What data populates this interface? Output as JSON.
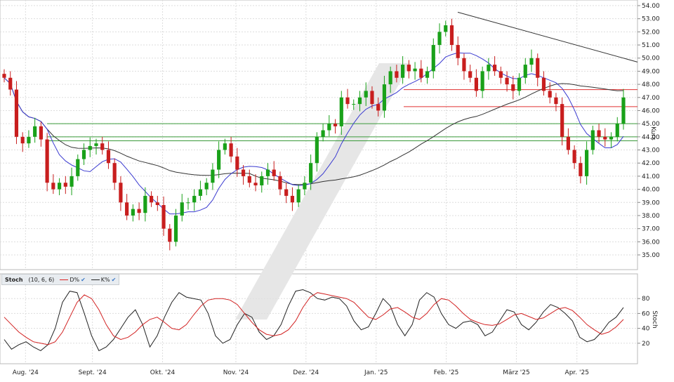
{
  "chart_data": [
    {
      "type": "candlestick",
      "ylabel": "Kurs",
      "ylim": [
        34,
        54
      ],
      "yticks": [
        "35.00",
        "36.00",
        "37.00",
        "38.00",
        "39.00",
        "40.00",
        "41.00",
        "42.00",
        "43.00",
        "44.00",
        "45.00",
        "46.00",
        "47.00",
        "48.00",
        "49.00",
        "50.00",
        "51.00",
        "52.00",
        "53.00",
        "54.00"
      ],
      "x_labels": [
        "Aug. '24",
        "Sept. '24",
        "Okt. '24",
        "Nov. '24",
        "Dez. '24",
        "Jan. '25",
        "Feb. '25",
        "März '25",
        "Apr. '25"
      ],
      "grid": true,
      "horizontal_lines": [
        {
          "value": 47.6,
          "color": "#e03030"
        },
        {
          "value": 46.3,
          "color": "#e03030"
        },
        {
          "value": 45.0,
          "color": "#3a9a3a"
        },
        {
          "value": 44.0,
          "color": "#3a9a3a"
        },
        {
          "value": 43.7,
          "color": "#3a9a3a"
        }
      ],
      "trendline": {
        "from_date": "Feb. '25",
        "from_value": 53.5,
        "to_value": 49.7,
        "color": "#333333"
      },
      "series": [
        {
          "kind": "close",
          "values": [
            48.5,
            47.6,
            44.0,
            43.5,
            44.0,
            44.8,
            43.8,
            40.5,
            40.0,
            40.5,
            40.2,
            41.0,
            42.3,
            43.0,
            43.3,
            43.5,
            43.0,
            42.0,
            40.5,
            39.0,
            38.0,
            38.5,
            38.2,
            39.5,
            39.0,
            38.8,
            37.0,
            36.0,
            38.0,
            39.0,
            39.0,
            39.5,
            40.0,
            40.5,
            41.5,
            43.0,
            43.5,
            42.5,
            41.5,
            41.0,
            40.5,
            40.3,
            41.0,
            41.5,
            41.0,
            40.0,
            39.5,
            39.0,
            40.0,
            40.5,
            42.0,
            44.0,
            44.5,
            45.0,
            44.8,
            47.0,
            46.5,
            46.5,
            47.0,
            47.5,
            46.5,
            46.0,
            48.0,
            49.0,
            48.5,
            49.5,
            49.0,
            49.2,
            48.5,
            49.0,
            51.0,
            52.0,
            52.5,
            51.0,
            50.0,
            49.0,
            48.5,
            47.5,
            49.0,
            49.5,
            49.0,
            48.5,
            48.0,
            47.5,
            48.5,
            49.5,
            50.0,
            48.5,
            47.5,
            47.0,
            46.5,
            44.0,
            43.0,
            42.0,
            41.0,
            43.0,
            44.5,
            44.0,
            43.8,
            44.0,
            45.0,
            47.0
          ]
        },
        {
          "kind": "moving-average-short",
          "color": "#3a3ad0"
        },
        {
          "kind": "moving-average-long",
          "color": "#333333"
        }
      ]
    },
    {
      "type": "line",
      "title": "Stoch",
      "params": "(10, 6, 6)",
      "ylim": [
        0,
        100
      ],
      "yticks": [
        "20",
        "40",
        "60",
        "80"
      ],
      "ylabel": "Stoch",
      "legend": [
        "D%",
        "K%"
      ],
      "series": [
        {
          "name": "K%",
          "color": "#222222",
          "values": [
            25,
            12,
            18,
            22,
            15,
            10,
            18,
            40,
            75,
            90,
            88,
            60,
            30,
            10,
            15,
            25,
            40,
            55,
            65,
            45,
            15,
            30,
            55,
            75,
            88,
            82,
            80,
            78,
            60,
            30,
            20,
            25,
            45,
            60,
            55,
            35,
            25,
            30,
            45,
            70,
            90,
            92,
            88,
            80,
            78,
            82,
            80,
            70,
            50,
            38,
            42,
            60,
            80,
            70,
            45,
            30,
            45,
            78,
            88,
            82,
            60,
            45,
            40,
            48,
            50,
            45,
            30,
            35,
            50,
            65,
            62,
            45,
            38,
            48,
            62,
            72,
            68,
            60,
            50,
            28,
            22,
            25,
            35,
            48,
            55,
            68
          ]
        },
        {
          "name": "D%",
          "color": "#d22222",
          "values": [
            55,
            45,
            35,
            28,
            22,
            20,
            18,
            22,
            35,
            55,
            75,
            85,
            80,
            65,
            45,
            30,
            25,
            28,
            35,
            45,
            52,
            55,
            48,
            40,
            38,
            45,
            58,
            70,
            78,
            80,
            80,
            78,
            72,
            60,
            48,
            38,
            32,
            30,
            32,
            38,
            50,
            68,
            82,
            88,
            86,
            84,
            82,
            80,
            75,
            65,
            55,
            52,
            58,
            66,
            68,
            62,
            55,
            52,
            60,
            72,
            80,
            78,
            70,
            60,
            52,
            48,
            45,
            44,
            46,
            52,
            58,
            60,
            56,
            52,
            54,
            60,
            66,
            68,
            64,
            55,
            45,
            38,
            32,
            35,
            42,
            52
          ]
        }
      ]
    }
  ]
}
